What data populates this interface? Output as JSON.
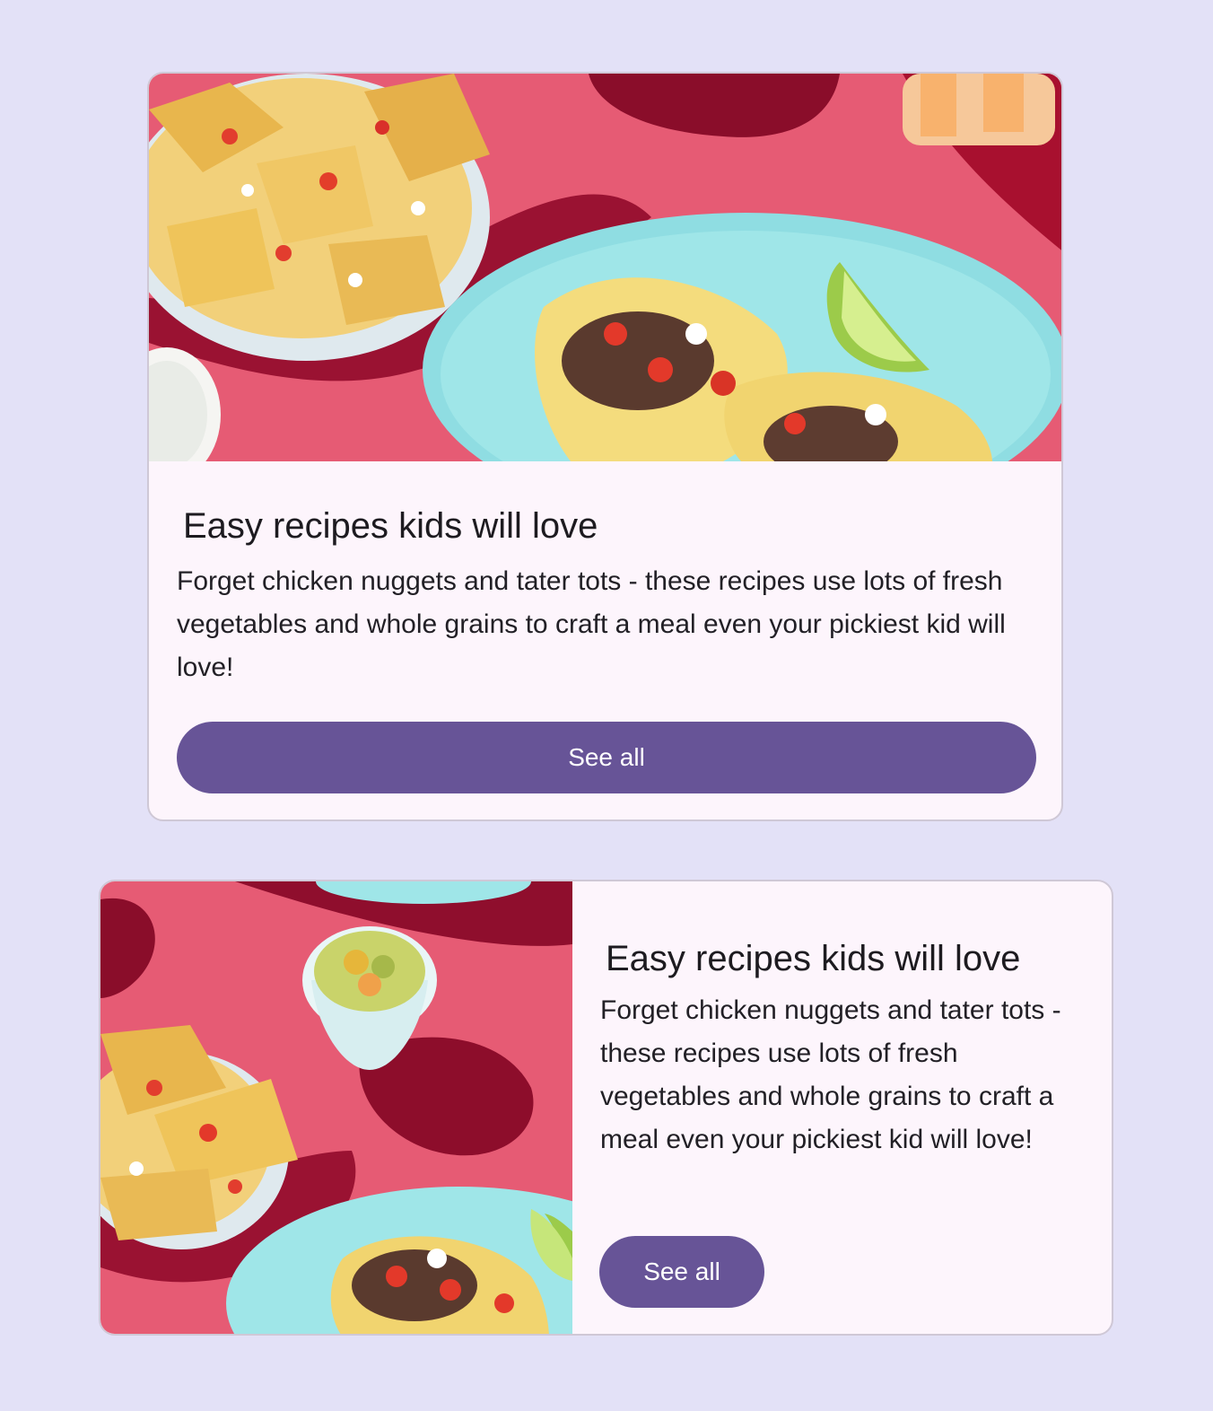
{
  "cards": [
    {
      "title": "Easy recipes kids will love",
      "description": "Forget chicken nuggets and tater tots - these recipes use lots of fresh vegetables and whole grains to craft a meal even your pickiest kid will love!",
      "button_label": "See all"
    },
    {
      "title": "Easy recipes kids will love",
      "description": "Forget chicken nuggets and tater tots - these recipes use lots of fresh vegetables and whole grains to craft a meal even your pickiest kid will love!",
      "button_label": "See all"
    }
  ],
  "colors": {
    "page_background": "#e3e1f7",
    "card_surface": "#fdf5fc",
    "primary_button": "#675497",
    "tablecloth": "#e65b74"
  },
  "media_description_icons": [
    "nachos-plate-image",
    "tacos-plate-image",
    "jalapeno-bowl-image"
  ]
}
